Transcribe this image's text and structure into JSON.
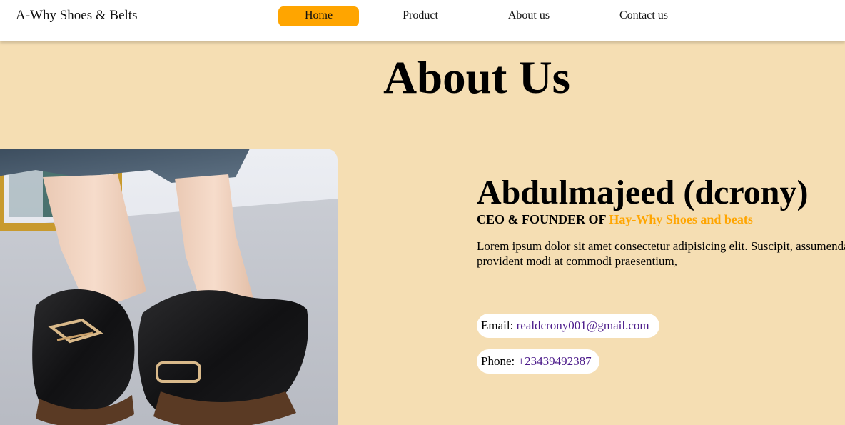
{
  "nav": {
    "brand": "A-Why Shoes & Belts",
    "items": [
      {
        "label": "Home",
        "active": true
      },
      {
        "label": "Product",
        "active": false
      },
      {
        "label": "About us",
        "active": false
      },
      {
        "label": "Contact us",
        "active": false
      }
    ]
  },
  "page": {
    "title": "About Us"
  },
  "profile": {
    "image_alt": "black loafer shoes with gold buckle",
    "name": "Abdulmajeed (dcrony)",
    "role_prefix": "CEO & FOUNDER OF",
    "role_brand": "Hay-Why Shoes and beats",
    "bio": "Lorem ipsum dolor sit amet consectetur adipisicing elit. Suscipit, assumenda provident modi at commodi praesentium,",
    "email_label": "Email:",
    "email": "realdcrony001@gmail.com",
    "phone_label": "Phone:",
    "phone": "+23439492387"
  },
  "colors": {
    "accent": "#ffa500",
    "background": "#f5deb3",
    "link": "#4b1a8a"
  }
}
